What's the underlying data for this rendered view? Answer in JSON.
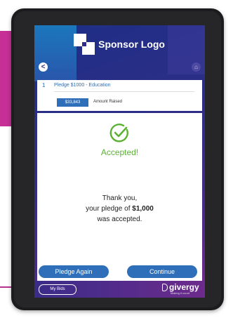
{
  "app": {
    "sponsor_logo_text": "Sponsor Logo",
    "brand_name": "givergy",
    "brand_tagline": "Making it count"
  },
  "nav": {
    "back_icon": "chevron-left-icon",
    "home_icon": "home-icon",
    "back_glyph": "<",
    "home_glyph": "⌂"
  },
  "pledge": {
    "number": "1",
    "title": "Pledge $1000 - Education",
    "amount_raised_value": "$33,843",
    "amount_raised_label": "Amount Raised"
  },
  "confirmation": {
    "status_icon": "checkmark-circle-icon",
    "status_text": "Accepted!",
    "line1": "Thank you,",
    "line2_prefix": "your pledge of ",
    "line2_amount": "$1,000",
    "line3": "was accepted."
  },
  "actions": {
    "pledge_again_label": "Pledge Again",
    "continue_label": "Continue",
    "my_bids_label": "My Bids"
  },
  "colors": {
    "accent_blue": "#2f6fba",
    "success_green": "#5cb135",
    "brand_purple": "#2f2d86",
    "magenta": "#c62f96"
  }
}
